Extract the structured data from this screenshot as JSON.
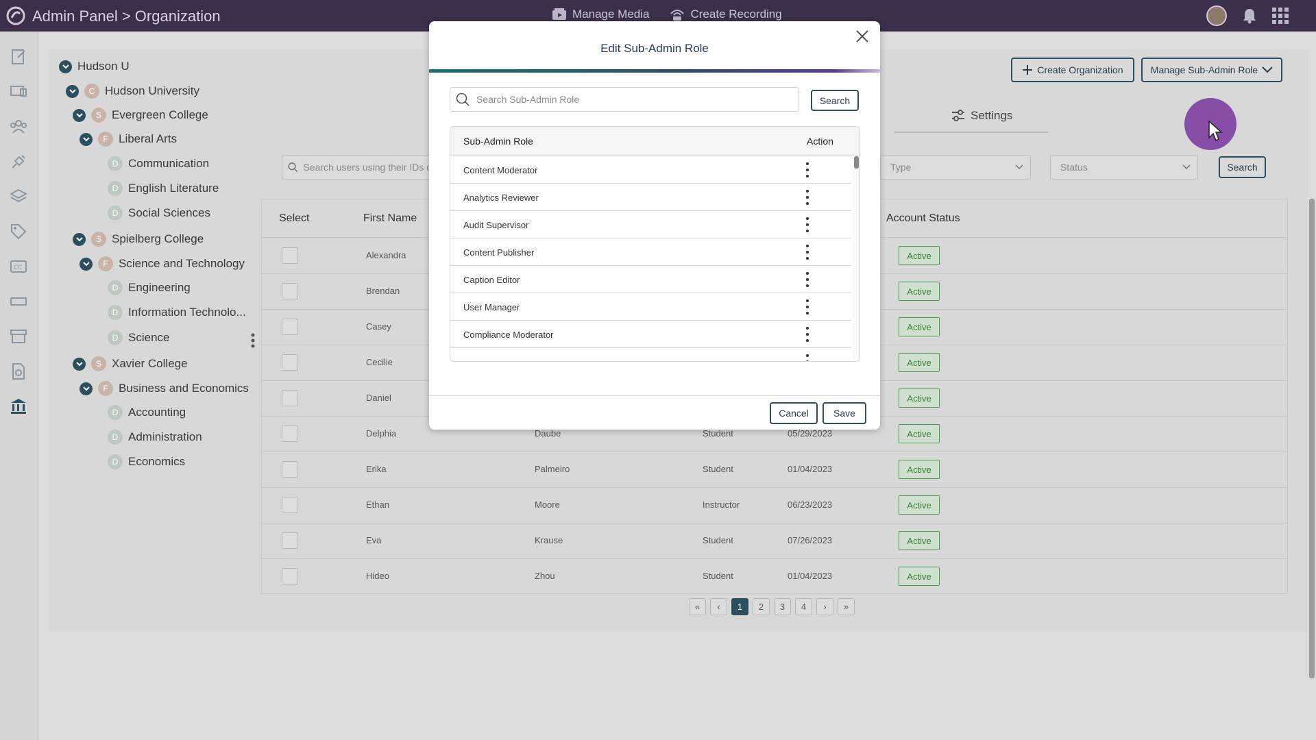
{
  "header": {
    "title": "Admin Panel > Organization",
    "manage_media": "Manage Media",
    "create_recording": "Create Recording"
  },
  "tree": [
    {
      "label": "Hudson U",
      "badge": ""
    },
    {
      "label": "Hudson University",
      "badge": "C"
    },
    {
      "label": "Evergreen College",
      "badge": "S"
    },
    {
      "label": "Liberal Arts",
      "badge": "F"
    },
    {
      "label": "Communication",
      "badge": "D"
    },
    {
      "label": "English Literature",
      "badge": "D"
    },
    {
      "label": "Social Sciences",
      "badge": "D"
    },
    {
      "label": "Spielberg College",
      "badge": "S"
    },
    {
      "label": "Science and Technology",
      "badge": "F"
    },
    {
      "label": "Engineering",
      "badge": "D"
    },
    {
      "label": "Information Technolo...",
      "badge": "D"
    },
    {
      "label": "Science",
      "badge": "D"
    },
    {
      "label": "Xavier College",
      "badge": "S"
    },
    {
      "label": "Business and Economics",
      "badge": "F"
    },
    {
      "label": "Accounting",
      "badge": "D"
    },
    {
      "label": "Administration",
      "badge": "D"
    },
    {
      "label": "Economics",
      "badge": "D"
    }
  ],
  "toolbar": {
    "create_org": "Create Organization",
    "manage_subadmin": "Manage Sub-Admin Role",
    "settings": "Settings"
  },
  "filters": {
    "search_placeholder": "Search users using their IDs o",
    "type": "Type",
    "status": "Status",
    "search_btn": "Search"
  },
  "table": {
    "headers": {
      "select": "Select",
      "first_name": "First Name",
      "account_status": "Account Status"
    },
    "rows": [
      {
        "first": "Alexandra",
        "last": "",
        "role": "",
        "date": "",
        "status": "Active"
      },
      {
        "first": "Brendan",
        "last": "",
        "role": "",
        "date": "",
        "status": "Active"
      },
      {
        "first": "Casey",
        "last": "",
        "role": "",
        "date": "",
        "status": "Active"
      },
      {
        "first": "Cecilie",
        "last": "",
        "role": "",
        "date": "",
        "status": "Active"
      },
      {
        "first": "Daniel",
        "last": "",
        "role": "",
        "date": "",
        "status": "Active"
      },
      {
        "first": "Delphia",
        "last": "Daube",
        "role": "Student",
        "date": "05/29/2023",
        "status": "Active"
      },
      {
        "first": "Erika",
        "last": "Palmeiro",
        "role": "Student",
        "date": "01/04/2023",
        "status": "Active"
      },
      {
        "first": "Ethan",
        "last": "Moore",
        "role": "Instructor",
        "date": "06/23/2023",
        "status": "Active"
      },
      {
        "first": "Eva",
        "last": "Krause",
        "role": "Student",
        "date": "07/26/2023",
        "status": "Active"
      },
      {
        "first": "Hideo",
        "last": "Zhou",
        "role": "Student",
        "date": "01/04/2023",
        "status": "Active"
      }
    ]
  },
  "pagination": {
    "first": "«",
    "prev": "‹",
    "pages": [
      "1",
      "2",
      "3",
      "4"
    ],
    "next": "›",
    "last": "»"
  },
  "modal": {
    "title": "Edit Sub-Admin Role",
    "search_placeholder": "Search Sub-Admin Role",
    "search_btn": "Search",
    "col_role": "Sub-Admin Role",
    "col_action": "Action",
    "roles": [
      "Content Moderator",
      "Analytics Reviewer",
      "Audit Supervisor",
      "Content Publisher",
      "Caption Editor",
      "User Manager",
      "Compliance Moderator"
    ],
    "cancel": "Cancel",
    "save": "Save"
  },
  "colors": {
    "topbar": "#3b2f4a",
    "accent": "#2b4f5f",
    "cursor_highlight": "#7e3fa3",
    "active_green": "#3c7f3c"
  }
}
